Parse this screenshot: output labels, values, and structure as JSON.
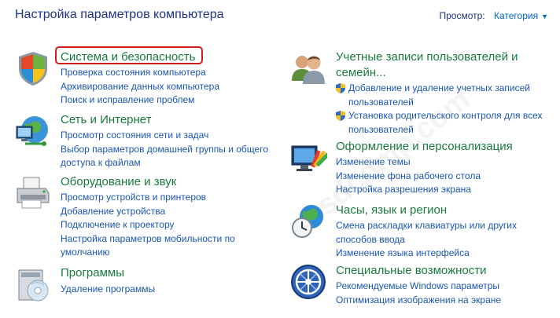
{
  "header": {
    "title": "Настройка параметров компьютера",
    "view_by_label": "Просмотр:",
    "view_by_value": "Категория"
  },
  "watermark": "sdcomp.com",
  "categories": [
    {
      "title": "Система и безопасность",
      "icon": "shield-flag-icon",
      "links": [
        "Проверка состояния компьютера",
        "Архивирование данных компьютера",
        "Поиск и исправление проблем"
      ]
    },
    {
      "title": "Сеть и Интернет",
      "icon": "network-globe-icon",
      "links": [
        "Просмотр состояния сети и задач",
        "Выбор параметров домашней группы и общего доступа к файлам"
      ]
    },
    {
      "title": "Оборудование и звук",
      "icon": "printer-icon",
      "links": [
        "Просмотр устройств и принтеров",
        "Добавление устройства",
        "Подключение к проектору",
        "Настройка параметров мобильности по умолчанию"
      ]
    },
    {
      "title": "Программы",
      "icon": "programs-cd-icon",
      "links": [
        "Удаление программы"
      ]
    },
    {
      "title": "Учетные записи пользователей и семейн...",
      "icon": "users-icon",
      "links": [
        "Добавление и удаление учетных записей пользователей",
        "Установка родительского контроля для всех пользователей"
      ]
    },
    {
      "title": "Оформление и персонализация",
      "icon": "monitor-palette-icon",
      "links": [
        "Изменение темы",
        "Изменение фона рабочего стола",
        "Настройка разрешения экрана"
      ]
    },
    {
      "title": "Часы, язык и регион",
      "icon": "clock-globe-icon",
      "links": [
        "Смена раскладки клавиатуры или других способов ввода",
        "Изменение языка интерфейса"
      ]
    },
    {
      "title": "Специальные возможности",
      "icon": "accessibility-icon",
      "links": [
        "Рекомендуемые Windows параметры",
        "Оптимизация изображения на экране"
      ]
    }
  ]
}
